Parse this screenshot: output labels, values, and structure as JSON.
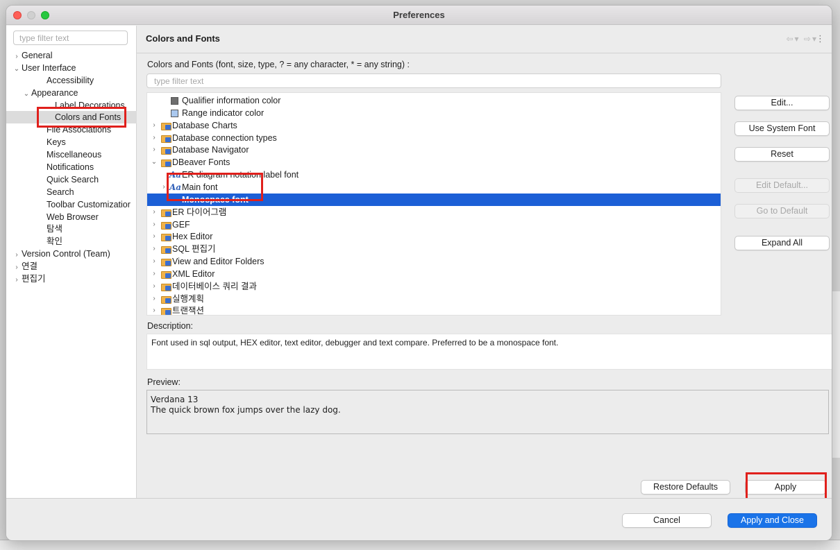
{
  "window": {
    "title": "Preferences"
  },
  "left": {
    "filter_placeholder": "type filter text",
    "items": [
      {
        "label": "General",
        "chevron": "›"
      },
      {
        "label": "User Interface",
        "chevron": "⌄"
      },
      {
        "label": "Accessibility",
        "chevron": ""
      },
      {
        "label": "Appearance",
        "chevron": "⌄"
      },
      {
        "label": "Label Decorations",
        "chevron": ""
      },
      {
        "label": "Colors and Fonts",
        "chevron": ""
      },
      {
        "label": "File Associations",
        "chevron": ""
      },
      {
        "label": "Keys",
        "chevron": ""
      },
      {
        "label": "Miscellaneous",
        "chevron": ""
      },
      {
        "label": "Notifications",
        "chevron": ""
      },
      {
        "label": "Quick Search",
        "chevron": ""
      },
      {
        "label": "Search",
        "chevron": ""
      },
      {
        "label": "Toolbar Customizatior",
        "chevron": ""
      },
      {
        "label": "Web Browser",
        "chevron": ""
      },
      {
        "label": "탐색",
        "chevron": ""
      },
      {
        "label": "확인",
        "chevron": ""
      },
      {
        "label": "Version Control (Team)",
        "chevron": "›"
      },
      {
        "label": "연결",
        "chevron": "›"
      },
      {
        "label": "편집기",
        "chevron": "›"
      }
    ]
  },
  "content": {
    "title": "Colors and Fonts",
    "nav_arrows": "⇦▾ ⇨▾",
    "kebab": "⋮",
    "tree_label": "Colors and Fonts (font, size, type, ? = any character, * = any string) :",
    "filter_placeholder": "type filter text",
    "tree": [
      {
        "label": "Qualifier information color",
        "chevron": ""
      },
      {
        "label": "Range indicator color",
        "chevron": ""
      },
      {
        "label": "Database Charts",
        "chevron": "›"
      },
      {
        "label": "Database connection types",
        "chevron": "›"
      },
      {
        "label": "Database Navigator",
        "chevron": "›"
      },
      {
        "label": "DBeaver Fonts",
        "chevron": "⌄"
      },
      {
        "label": "ER diagram notation label font",
        "chevron": ""
      },
      {
        "label": "Main font",
        "chevron": "›"
      },
      {
        "label": "Monospace font",
        "chevron": ""
      },
      {
        "label": "ER 다이어그램",
        "chevron": "›"
      },
      {
        "label": "GEF",
        "chevron": "›"
      },
      {
        "label": "Hex Editor",
        "chevron": "›"
      },
      {
        "label": "SQL 편집기",
        "chevron": "›"
      },
      {
        "label": "View and Editor Folders",
        "chevron": "›"
      },
      {
        "label": "XML Editor",
        "chevron": "›"
      },
      {
        "label": "데이터베이스 쿼리 결과",
        "chevron": "›"
      },
      {
        "label": "실행계획",
        "chevron": "›"
      },
      {
        "label": "트랜잭션",
        "chevron": "›"
      }
    ],
    "font_icon": "Aa",
    "buttons": {
      "edit": "Edit...",
      "use_system_font": "Use System Font",
      "reset": "Reset",
      "edit_default": "Edit Default...",
      "go_to_default": "Go to Default",
      "expand_all": "Expand All"
    },
    "description_label": "Description:",
    "description": "Font used in sql output, HEX editor, text editor, debugger and text compare. Preferred to be a monospace font.",
    "preview_label": "Preview:",
    "preview_line1": "Verdana 13",
    "preview_line2": "The quick brown fox jumps over the lazy dog.",
    "restore_defaults": "Restore Defaults",
    "apply": "Apply"
  },
  "footer": {
    "cancel": "Cancel",
    "apply_and_close": "Apply and Close"
  },
  "colors": {
    "selection": "#1c5fd6",
    "primary_button": "#1a73e8",
    "highlight_box": "#e0201c",
    "qualifier_swatch": "#6e6e6e",
    "range_swatch": "#aac8ee"
  }
}
